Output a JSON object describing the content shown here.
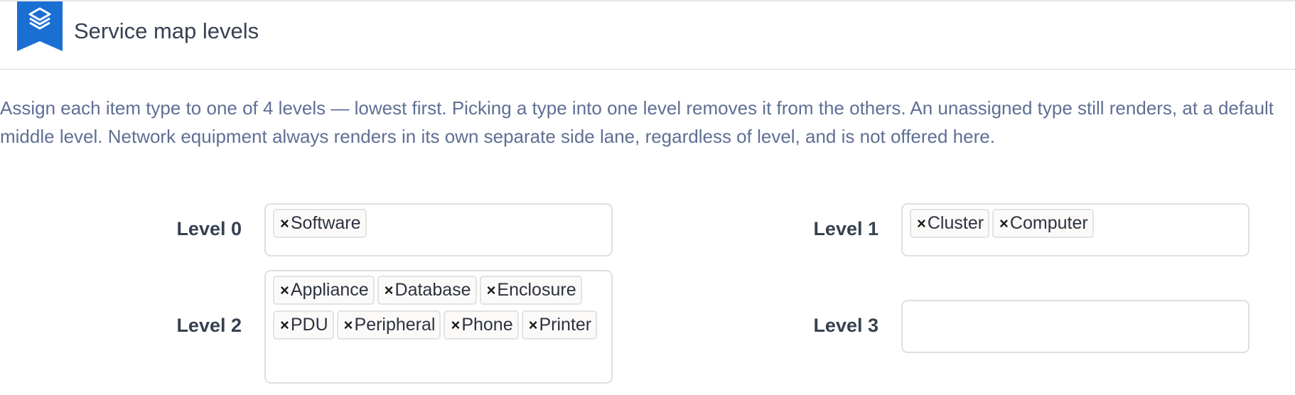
{
  "header": {
    "title": "Service map levels",
    "icon": "layers-icon",
    "accent_color": "#1a6fd3"
  },
  "description": "Assign each item type to one of 4 levels — lowest first. Picking a type into one level removes it from the others. An unassigned type still renders, at a default middle level. Network equipment always renders in its own separate side lane, regardless of level, and is not offered here.",
  "remove_glyph": "×",
  "levels": [
    {
      "label": "Level 0",
      "items": [
        "Software"
      ]
    },
    {
      "label": "Level 1",
      "items": [
        "Cluster",
        "Computer"
      ]
    },
    {
      "label": "Level 2",
      "items": [
        "Appliance",
        "Database",
        "Enclosure",
        "PDU",
        "Peripheral",
        "Phone",
        "Printer"
      ]
    },
    {
      "label": "Level 3",
      "items": []
    }
  ]
}
